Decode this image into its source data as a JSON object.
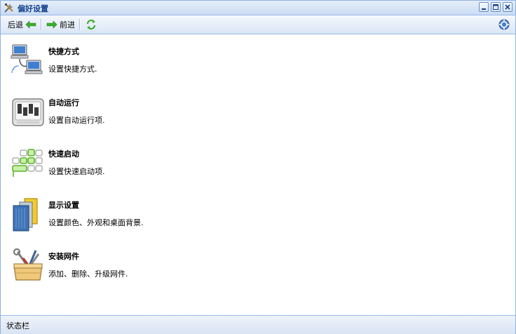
{
  "window": {
    "title": "偏好设置",
    "app_icon": "tools-icon",
    "controls": [
      "minimize-icon",
      "maximize-icon",
      "close-icon"
    ]
  },
  "toolbar": {
    "back_label": "后退",
    "forward_label": "前进",
    "refresh_icon": "refresh-icon",
    "help_icon": "help-icon"
  },
  "items": [
    {
      "name": "快捷方式",
      "description": "设置快捷方式.",
      "icon": "network-computers-icon"
    },
    {
      "name": "自动运行",
      "description": "设置自动运行项.",
      "icon": "control-panel-icon"
    },
    {
      "name": "快速启动",
      "description": "设置快速启动项.",
      "icon": "quick-launch-grid-icon"
    },
    {
      "name": "显示设置",
      "description": "设置颜色、外观和桌面背景.",
      "icon": "display-settings-icon"
    },
    {
      "name": "安装网件",
      "description": "添加、删除、升级网件.",
      "icon": "toolbox-icon"
    }
  ],
  "statusbar": {
    "text": "状态栏"
  },
  "colors": {
    "title_text": "#15428b",
    "border": "#99bbe8",
    "arrow_green": "#3cae2c"
  }
}
